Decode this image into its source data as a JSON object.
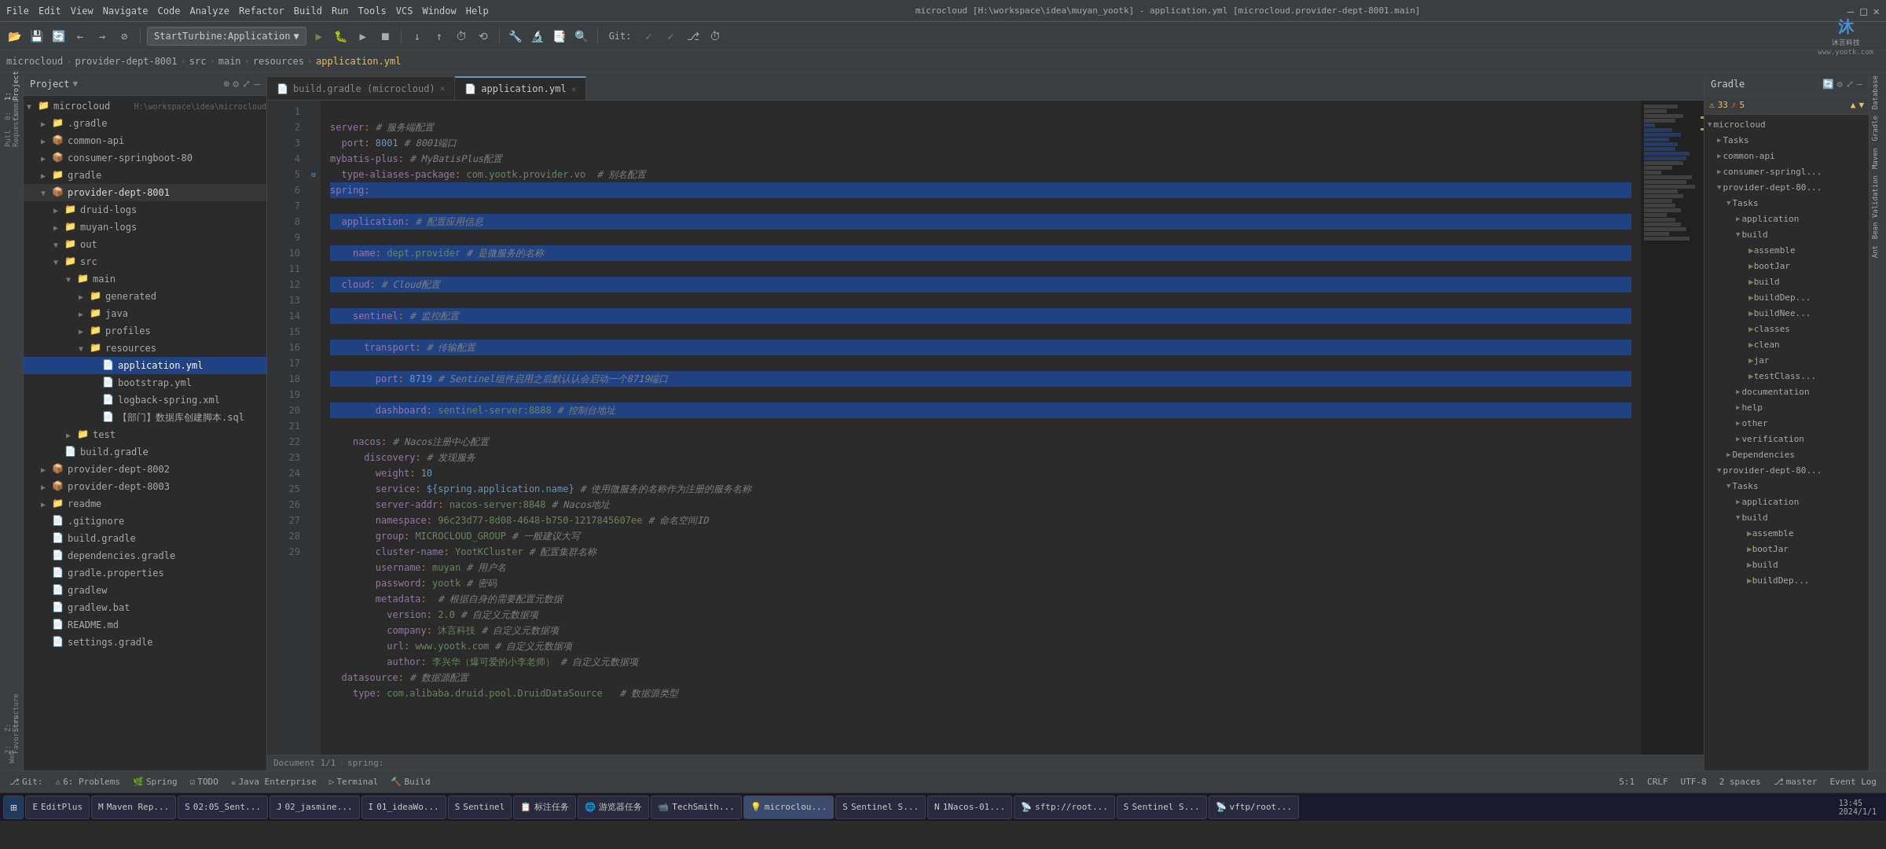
{
  "titleBar": {
    "menuItems": [
      "File",
      "Edit",
      "View",
      "Navigate",
      "Code",
      "Analyze",
      "Refactor",
      "Build",
      "Run",
      "Tools",
      "VCS",
      "Window",
      "Help"
    ],
    "windowTitle": "microcloud [H:\\workspace\\idea\\muyan_yootk] - application.yml [microcloud.provider-dept-8001.main]",
    "controls": [
      "—",
      "□",
      "✕"
    ]
  },
  "toolbar": {
    "dropdownLabel": "StartTurbine:Application",
    "gitLabel": "Git:",
    "icons": [
      "📁",
      "💾",
      "🔄",
      "←",
      "→",
      "⊘",
      "▶",
      "⏸",
      "⏹",
      "🐛",
      "📦",
      "🔧",
      "🔍",
      "♻"
    ]
  },
  "breadcrumb": {
    "items": [
      "microcloud",
      "provider-dept-8001",
      "src",
      "main",
      "resources",
      "application.yml"
    ]
  },
  "project": {
    "title": "Project",
    "rootName": "microcloud",
    "rootPath": "H:\\workspace\\idea\\microcloud",
    "items": [
      {
        "id": "microcloud",
        "label": "microcloud",
        "type": "root",
        "indent": 0,
        "expanded": true
      },
      {
        "id": "gradle-hidden",
        "label": ".gradle",
        "type": "folder",
        "indent": 1,
        "expanded": false
      },
      {
        "id": "common-api",
        "label": "common-api",
        "type": "module",
        "indent": 1,
        "expanded": false
      },
      {
        "id": "consumer-springboot-80",
        "label": "consumer-springboot-80",
        "type": "module",
        "indent": 1,
        "expanded": false
      },
      {
        "id": "gradle",
        "label": "gradle",
        "type": "folder",
        "indent": 1,
        "expanded": false
      },
      {
        "id": "provider-dept-8001",
        "label": "provider-dept-8001",
        "type": "module",
        "indent": 1,
        "expanded": true
      },
      {
        "id": "druid-logs",
        "label": "druid-logs",
        "type": "folder",
        "indent": 2,
        "expanded": false
      },
      {
        "id": "muyan-logs",
        "label": "muyan-logs",
        "type": "folder",
        "indent": 2,
        "expanded": false
      },
      {
        "id": "out",
        "label": "out",
        "type": "folder",
        "indent": 2,
        "expanded": false
      },
      {
        "id": "src",
        "label": "src",
        "type": "folder",
        "indent": 2,
        "expanded": true
      },
      {
        "id": "main",
        "label": "main",
        "type": "folder",
        "indent": 3,
        "expanded": true
      },
      {
        "id": "generated",
        "label": "generated",
        "type": "folder",
        "indent": 4,
        "expanded": false
      },
      {
        "id": "java",
        "label": "java",
        "type": "folder",
        "indent": 4,
        "expanded": false
      },
      {
        "id": "profiles",
        "label": "profiles",
        "type": "folder",
        "indent": 4,
        "expanded": false
      },
      {
        "id": "resources",
        "label": "resources",
        "type": "folder",
        "indent": 4,
        "expanded": true
      },
      {
        "id": "application.yml",
        "label": "application.yml",
        "type": "yaml",
        "indent": 5,
        "expanded": false,
        "selected": true
      },
      {
        "id": "bootstrap.yml",
        "label": "bootstrap.yml",
        "type": "yaml",
        "indent": 5,
        "expanded": false
      },
      {
        "id": "logback-spring.xml",
        "label": "logback-spring.xml",
        "type": "xml",
        "indent": 5,
        "expanded": false
      },
      {
        "id": "sql",
        "label": "【部门】数据库创建脚本.sql",
        "type": "sql",
        "indent": 5,
        "expanded": false
      },
      {
        "id": "test",
        "label": "test",
        "type": "folder",
        "indent": 3,
        "expanded": false
      },
      {
        "id": "build.gradle-8001",
        "label": "build.gradle",
        "type": "gradle",
        "indent": 2,
        "expanded": false
      },
      {
        "id": "provider-dept-8002",
        "label": "provider-dept-8002",
        "type": "module",
        "indent": 1,
        "expanded": false
      },
      {
        "id": "provider-dept-8003",
        "label": "provider-dept-8003",
        "type": "module",
        "indent": 1,
        "expanded": false
      },
      {
        "id": "readme",
        "label": "readme",
        "type": "folder",
        "indent": 1,
        "expanded": false
      },
      {
        "id": ".gitignore",
        "label": ".gitignore",
        "type": "git",
        "indent": 1,
        "expanded": false
      },
      {
        "id": "build.gradle",
        "label": "build.gradle",
        "type": "gradle",
        "indent": 1,
        "expanded": false
      },
      {
        "id": "dependencies.gradle",
        "label": "dependencies.gradle",
        "type": "gradle",
        "indent": 1,
        "expanded": false
      },
      {
        "id": "gradle.properties",
        "label": "gradle.properties",
        "type": "file",
        "indent": 1,
        "expanded": false
      },
      {
        "id": "gradlew",
        "label": "gradlew",
        "type": "file",
        "indent": 1,
        "expanded": false
      },
      {
        "id": "gradlew.bat",
        "label": "gradlew.bat",
        "type": "file",
        "indent": 1,
        "expanded": false
      },
      {
        "id": "README.md",
        "label": "README.md",
        "type": "md",
        "indent": 1,
        "expanded": false
      },
      {
        "id": "settings.gradle",
        "label": "settings.gradle",
        "type": "gradle",
        "indent": 1,
        "expanded": false
      }
    ]
  },
  "editor": {
    "tabs": [
      {
        "id": "build-gradle",
        "label": "build.gradle (microcloud)",
        "active": false
      },
      {
        "id": "application-yml",
        "label": "application.yml",
        "active": true
      }
    ],
    "lines": [
      {
        "num": 1,
        "content": "server: # 服务端配置",
        "selected": false
      },
      {
        "num": 2,
        "content": "  port: 8001 # 8001端口",
        "selected": false
      },
      {
        "num": 3,
        "content": "mybatis-plus: # MyBatisPlus配置",
        "selected": false
      },
      {
        "num": 4,
        "content": "  type-aliases-package: com.yootk.provider.vo  # 别名配置",
        "selected": false
      },
      {
        "num": 5,
        "content": "spring:",
        "selected": true
      },
      {
        "num": 6,
        "content": "  application: # 配置应用信息",
        "selected": true
      },
      {
        "num": 7,
        "content": "    name: dept.provider # 是微服务的名称",
        "selected": true
      },
      {
        "num": 8,
        "content": "  cloud: # Cloud配置",
        "selected": true
      },
      {
        "num": 9,
        "content": "    sentinel: # 监控配置",
        "selected": true
      },
      {
        "num": 10,
        "content": "      transport: # 传输配置",
        "selected": true
      },
      {
        "num": 11,
        "content": "        port: 8719 # Sentinel组件启用之后默认认会启动一个8719端口",
        "selected": true
      },
      {
        "num": 12,
        "content": "        dashboard: sentinel-server:8888 # 控制台地址",
        "selected": true
      },
      {
        "num": 13,
        "content": "    nacos: # Nacos注册中心配置",
        "selected": false
      },
      {
        "num": 14,
        "content": "      discovery: # 发现服务",
        "selected": false
      },
      {
        "num": 15,
        "content": "        weight: 10",
        "selected": false
      },
      {
        "num": 16,
        "content": "        service: ${spring.application.name} # 使用微服务的名称作为注册的服务名称",
        "selected": false
      },
      {
        "num": 17,
        "content": "        server-addr: nacos-server:8848 # Nacos地址",
        "selected": false
      },
      {
        "num": 18,
        "content": "        namespace: 96c23d77-8d08-4648-b750-1217845607ee # 命名空间ID",
        "selected": false
      },
      {
        "num": 19,
        "content": "        group: MICROCLOUD_GROUP # 一般建议大写",
        "selected": false
      },
      {
        "num": 20,
        "content": "        cluster-name: YootKCluster # 配置集群名称",
        "selected": false
      },
      {
        "num": 21,
        "content": "        username: muyan # 用户名",
        "selected": false
      },
      {
        "num": 22,
        "content": "        password: yootk # 密码",
        "selected": false
      },
      {
        "num": 23,
        "content": "        metadata:  # 根据自身的需要配置元数据",
        "selected": false
      },
      {
        "num": 24,
        "content": "          version: 2.0 # 自定义元数据项",
        "selected": false
      },
      {
        "num": 25,
        "content": "          company: 沐言科技 # 自定义元数据项",
        "selected": false
      },
      {
        "num": 26,
        "content": "          url: www.yootk.com # 自定义元数据项",
        "selected": false
      },
      {
        "num": 27,
        "content": "          author: 李兴华（爆可爱的小李老师） # 自定义元数据项",
        "selected": false
      },
      {
        "num": 28,
        "content": "  datasource: # 数据源配置",
        "selected": false
      },
      {
        "num": 29,
        "content": "    type: com.alibaba.druid.pool.DruidDataSource   # 数据源类型",
        "selected": false
      }
    ],
    "footer": {
      "docInfo": "Document 1/1",
      "breadcrumb": "spring:",
      "position": "5:1",
      "lineEnding": "CRLF",
      "encoding": "UTF-8",
      "indent": "2 spaces",
      "errors": "⚠ 33  ✗ 5"
    }
  },
  "gradle": {
    "title": "Gradle",
    "items": [
      {
        "label": "microcloud",
        "indent": 0,
        "type": "root"
      },
      {
        "label": "Tasks",
        "indent": 1,
        "type": "folder"
      },
      {
        "label": "common-api",
        "indent": 1,
        "type": "module"
      },
      {
        "label": "consumer-springl",
        "indent": 1,
        "type": "module"
      },
      {
        "label": "provider-dept-80",
        "indent": 1,
        "type": "module"
      },
      {
        "label": "Tasks",
        "indent": 2,
        "type": "folder"
      },
      {
        "label": "application",
        "indent": 3,
        "type": "folder"
      },
      {
        "label": "build",
        "indent": 3,
        "type": "folder"
      },
      {
        "label": "assemble",
        "indent": 4,
        "type": "task"
      },
      {
        "label": "bootJar",
        "indent": 4,
        "type": "task"
      },
      {
        "label": "build",
        "indent": 4,
        "type": "task"
      },
      {
        "label": "buildDep...",
        "indent": 4,
        "type": "task"
      },
      {
        "label": "buildNee...",
        "indent": 4,
        "type": "task"
      },
      {
        "label": "classes",
        "indent": 4,
        "type": "task"
      },
      {
        "label": "clean",
        "indent": 4,
        "type": "task"
      },
      {
        "label": "jar",
        "indent": 4,
        "type": "task"
      },
      {
        "label": "testClass...",
        "indent": 4,
        "type": "task"
      },
      {
        "label": "documentation",
        "indent": 3,
        "type": "folder"
      },
      {
        "label": "help",
        "indent": 3,
        "type": "folder"
      },
      {
        "label": "other",
        "indent": 3,
        "type": "folder"
      },
      {
        "label": "verification",
        "indent": 3,
        "type": "folder"
      },
      {
        "label": "Dependencies",
        "indent": 2,
        "type": "folder"
      },
      {
        "label": "provider-dept-80",
        "indent": 1,
        "type": "module"
      },
      {
        "label": "Tasks",
        "indent": 2,
        "type": "folder"
      },
      {
        "label": "application",
        "indent": 3,
        "type": "folder"
      },
      {
        "label": "build",
        "indent": 3,
        "type": "folder"
      },
      {
        "label": "assemble",
        "indent": 4,
        "type": "task"
      },
      {
        "label": "bootJar",
        "indent": 4,
        "type": "task"
      },
      {
        "label": "build",
        "indent": 4,
        "type": "task"
      },
      {
        "label": "buildDep...",
        "indent": 4,
        "type": "task"
      }
    ]
  },
  "statusBar": {
    "git": "Git:",
    "gitBranch": "master",
    "problems": "6: Problems",
    "spring": "Spring",
    "todo": "TODO",
    "javaEnterprise": "Java Enterprise",
    "terminal": "Terminal",
    "build": "Build",
    "docInfo": "Document 1/1",
    "springBreadcrumb": "spring:",
    "position": "5:1",
    "lineEnding": "CRLF",
    "encoding": "UTF-8",
    "indent": "2 spaces",
    "events": "Event Log",
    "errors": "33",
    "warnings": "5"
  },
  "taskbar": {
    "items": [
      {
        "label": "EditPlus",
        "active": false
      },
      {
        "label": "Maven Rep...",
        "active": false
      },
      {
        "label": "02:05_Sent...",
        "active": false
      },
      {
        "label": "02_Jasmine...",
        "active": false
      },
      {
        "label": "01_ideaWo...",
        "active": false
      },
      {
        "label": "Sentinel",
        "active": false
      },
      {
        "label": "标注任务",
        "active": false
      },
      {
        "label": "游览器任务",
        "active": false
      },
      {
        "label": "TechSmith...",
        "active": false
      },
      {
        "label": "microclou...",
        "active": true
      },
      {
        "label": "Sentinel S...",
        "active": false
      },
      {
        "label": "1Nacos-01...",
        "active": false
      },
      {
        "label": "sftp://root...",
        "active": false
      },
      {
        "label": "Sentinel S...",
        "active": false
      },
      {
        "label": "vftp/root...",
        "active": false
      }
    ]
  },
  "logo": {
    "companyName": "沐言科技",
    "website": "www.yootk.com"
  }
}
